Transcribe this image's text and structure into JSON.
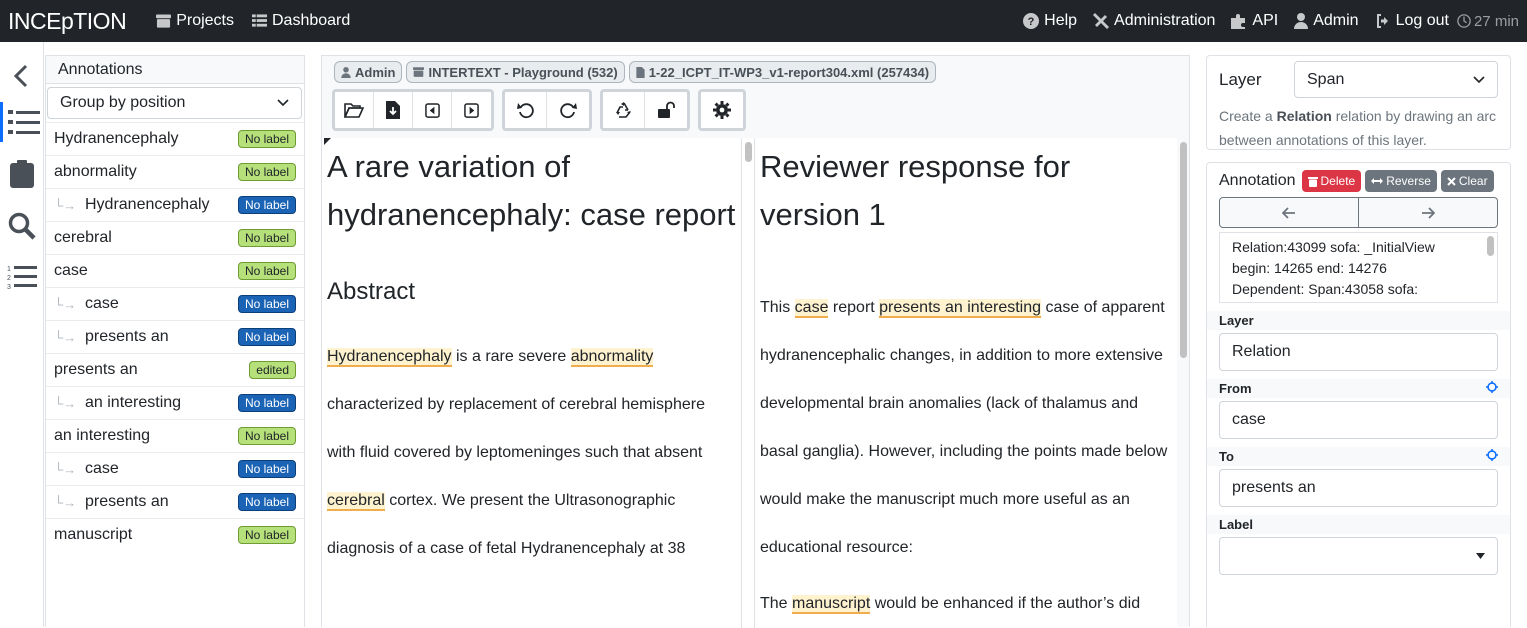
{
  "navbar": {
    "brand": "INCEpTION",
    "projects": "Projects",
    "dashboard": "Dashboard",
    "help": "Help",
    "administration": "Administration",
    "api": "API",
    "user": "Admin",
    "logout": "Log out",
    "timer": "27 min"
  },
  "sidebar": {
    "title": "Annotations",
    "group_by": "Group by position",
    "items": [
      {
        "text": "Hydranencephaly",
        "badge": "No label",
        "child": false,
        "color": "green"
      },
      {
        "text": "abnormality",
        "badge": "No label",
        "child": false,
        "color": "green"
      },
      {
        "text": "Hydranencephaly",
        "badge": "No label",
        "child": true,
        "color": "blue"
      },
      {
        "text": "cerebral",
        "badge": "No label",
        "child": false,
        "color": "green"
      },
      {
        "text": "case",
        "badge": "No label",
        "child": false,
        "color": "green"
      },
      {
        "text": "case",
        "badge": "No label",
        "child": true,
        "color": "blue"
      },
      {
        "text": "presents an",
        "badge": "No label",
        "child": true,
        "color": "blue"
      },
      {
        "text": "presents an",
        "badge": "edited",
        "child": false,
        "color": "green"
      },
      {
        "text": "an interesting",
        "badge": "No label",
        "child": true,
        "color": "blue"
      },
      {
        "text": "an interesting",
        "badge": "No label",
        "child": false,
        "color": "green"
      },
      {
        "text": "case",
        "badge": "No label",
        "child": true,
        "color": "blue"
      },
      {
        "text": "presents an",
        "badge": "No label",
        "child": true,
        "color": "blue"
      },
      {
        "text": "manuscript",
        "badge": "No label",
        "child": false,
        "color": "green"
      }
    ]
  },
  "breadcrumbs": {
    "user": "Admin",
    "project": "INTERTEXT - Playground (532)",
    "document": "1-22_ICPT_IT-WP3_v1-report304.xml (257434)"
  },
  "doc_left": {
    "title": "A rare variation of hydranencephaly: case report",
    "section": "Abstract",
    "hl1": "Hydranencephaly",
    "t1": " is a rare severe ",
    "hl2": "abnormality",
    "t2": "characterized by replacement of cerebral hemisphere",
    "t3": "with fluid covered by leptomeninges such that absent",
    "hl3": "cerebral",
    "t4": " cortex. We present the Ultrasonographic",
    "t5": "diagnosis of a case of fetal Hydranencephaly at 38"
  },
  "doc_right": {
    "title": "Reviewer response for version 1",
    "a1": "This ",
    "hl1": "case",
    "a2": " report ",
    "hl2": "presents an interesting",
    "a3": " case of apparent",
    "l2": "hydranencephalic changes, in addition to more extensive",
    "l3": "developmental brain anomalies (lack of thalamus and",
    "l4": "basal ganglia). However, including the points made below",
    "l5": "would make the manuscript much more useful as an",
    "l6": "educational resource:",
    "b1": "The ",
    "hl3": "manuscript",
    "b2": " would be enhanced if the author’s did"
  },
  "layer_panel": {
    "label": "Layer",
    "value": "Span",
    "help_pre": "Create a ",
    "help_bold": "Relation",
    "help_post": " relation by drawing an arc between annotations of this layer."
  },
  "annotation_panel": {
    "title": "Annotation",
    "delete": "Delete",
    "reverse": "Reverse",
    "clear": "Clear",
    "info_l1": "Relation:43099 sofa: _InitialView",
    "info_l2": "begin: 14265 end: 14276",
    "info_l3": "Dependent: Span:43058 sofa:",
    "layer_label": "Layer",
    "layer_value": "Relation",
    "from_label": "From",
    "from_value": "case",
    "to_label": "To",
    "to_value": "presents an",
    "label_label": "Label",
    "label_value": ""
  }
}
